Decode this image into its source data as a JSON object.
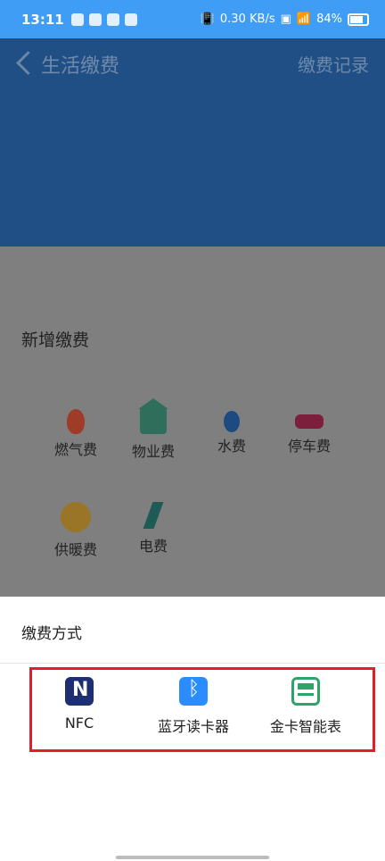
{
  "status_bar": {
    "time": "13:11",
    "net_speed_top": "0.30",
    "net_speed_unit": "KB/s",
    "battery_percent": "84%"
  },
  "header": {
    "title": "生活缴费",
    "record_label": "缴费记录"
  },
  "content": {
    "section_title": "新增缴费",
    "tiles": [
      {
        "label": "燃气费",
        "icon": "flame-icon"
      },
      {
        "label": "物业费",
        "icon": "house-yen-icon"
      },
      {
        "label": "水费",
        "icon": "water-drop-icon"
      },
      {
        "label": "停车费",
        "icon": "car-icon"
      },
      {
        "label": "供暖费",
        "icon": "radiator-icon"
      },
      {
        "label": "电费",
        "icon": "lightning-icon"
      }
    ]
  },
  "sheet": {
    "title": "缴费方式",
    "methods": [
      {
        "label": "NFC",
        "icon": "nfc-icon"
      },
      {
        "label": "蓝牙读卡器",
        "icon": "bluetooth-icon"
      },
      {
        "label": "金卡智能表",
        "icon": "smart-meter-card-icon"
      }
    ]
  },
  "colors": {
    "status_bar": "#3f9df6",
    "header_bg_dimmed": "#1f4f85",
    "overlay_bg": "#7f7f7f",
    "highlight_border": "#e01f2a"
  }
}
